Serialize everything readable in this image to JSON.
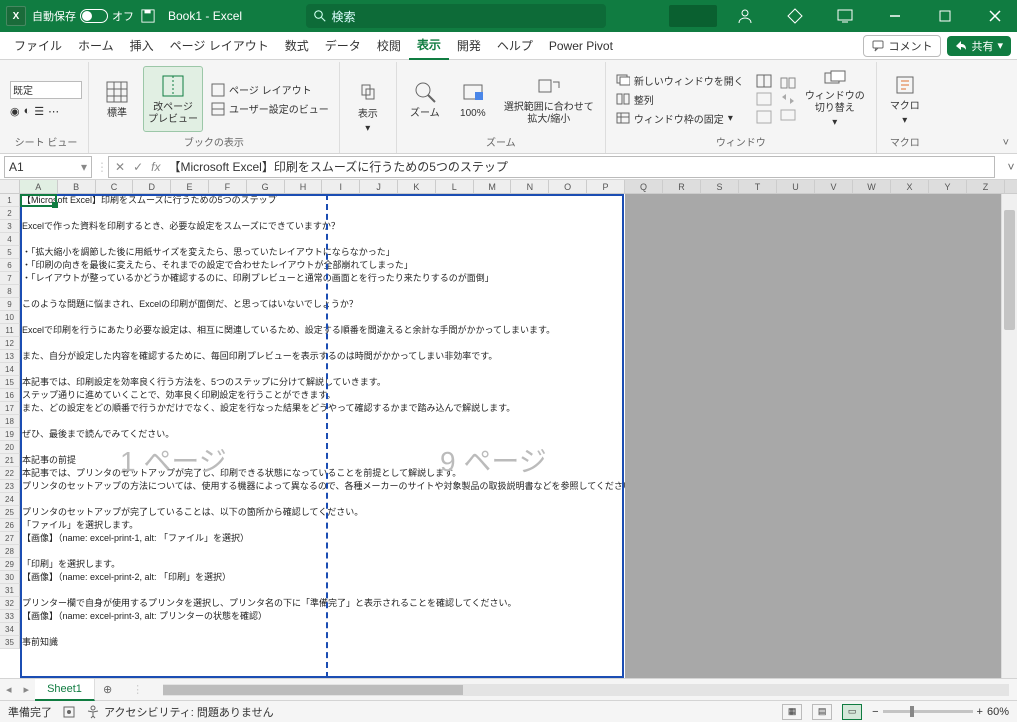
{
  "titlebar": {
    "autosave_label": "自動保存",
    "autosave_state": "オフ",
    "title": "Book1  -  Excel",
    "search_placeholder": "検索"
  },
  "menubar": {
    "tabs": [
      "ファイル",
      "ホーム",
      "挿入",
      "ページ レイアウト",
      "数式",
      "データ",
      "校閲",
      "表示",
      "開発",
      "ヘルプ",
      "Power Pivot"
    ],
    "active_index": 7,
    "comment": "コメント",
    "share": "共有"
  },
  "ribbon": {
    "sheetview": {
      "keep": "既定",
      "label": "シート ビュー"
    },
    "bookview": {
      "normal": "標準",
      "page_break": "改ページ\nプレビュー",
      "page_layout": "ページ レイアウト",
      "custom_view": "ユーザー設定のビュー",
      "label": "ブックの表示"
    },
    "show": {
      "btn": "表示",
      "label": ""
    },
    "zoom": {
      "zoom": "ズーム",
      "pct": "100%",
      "fit": "選択範囲に合わせて\n拡大/縮小",
      "label": "ズーム"
    },
    "window": {
      "new_window": "新しいウィンドウを開く",
      "arrange": "整列",
      "freeze": "ウィンドウ枠の固定",
      "switch": "ウィンドウの\n切り替え",
      "label": "ウィンドウ"
    },
    "macro": {
      "btn": "マクロ",
      "label": "マクロ"
    }
  },
  "formula": {
    "namebox": "A1",
    "value": "【Microsoft Excel】印刷をスムーズに行うための5つのステップ"
  },
  "columns": [
    "A",
    "B",
    "C",
    "D",
    "E",
    "F",
    "G",
    "H",
    "I",
    "J",
    "K",
    "L",
    "M",
    "N",
    "O",
    "P",
    "Q",
    "R",
    "S",
    "T",
    "U",
    "V",
    "W",
    "X",
    "Y",
    "Z"
  ],
  "watermarks": {
    "p1": "1 ページ",
    "p2": "9 ページ"
  },
  "rows": [
    {
      "n": 1,
      "t": "【Microsoft Excel】印刷をスムーズに行うための5つのステップ"
    },
    {
      "n": 2,
      "t": ""
    },
    {
      "n": 3,
      "t": "Excelで作った資料を印刷するとき、必要な設定をスムーズにできていますか？"
    },
    {
      "n": 4,
      "t": ""
    },
    {
      "n": 5,
      "t": "・「拡大縮小を調節した後に用紙サイズを変えたら、思っていたレイアウトにならなかった」"
    },
    {
      "n": 6,
      "t": "・「印刷の向きを最後に変えたら、それまでの設定で合わせたレイアウトが全部崩れてしまった」"
    },
    {
      "n": 7,
      "t": "・「レイアウトが整っているかどうか確認するのに、印刷プレビューと通常の画面とを行ったり来たりするのが面倒」"
    },
    {
      "n": 8,
      "t": ""
    },
    {
      "n": 9,
      "t": "このような問題に悩まされ、Excelの印刷が面倒だ、と思ってはいないでしょうか？"
    },
    {
      "n": 10,
      "t": ""
    },
    {
      "n": 11,
      "t": "Excelで印刷を行うにあたり必要な設定は、相互に関連しているため、設定する順番を間違えると余計な手間がかかってしまいます。"
    },
    {
      "n": 12,
      "t": ""
    },
    {
      "n": 13,
      "t": "また、自分が設定した内容を確認するために、毎回印刷プレビューを表示するのは時間がかかってしまい非効率です。"
    },
    {
      "n": 14,
      "t": ""
    },
    {
      "n": 15,
      "t": "本記事では、印刷設定を効率良く行う方法を、5つのステップに分けて解説していきます。"
    },
    {
      "n": 16,
      "t": "ステップ通りに進めていくことで、効率良く印刷設定を行うことができます。"
    },
    {
      "n": 17,
      "t": "また、どの設定をどの順番で行うかだけでなく、設定を行なった結果をどうやって確認するかまで踏み込んで解説します。"
    },
    {
      "n": 18,
      "t": ""
    },
    {
      "n": 19,
      "t": "ぜひ、最後まで読んでみてください。"
    },
    {
      "n": 20,
      "t": ""
    },
    {
      "n": 21,
      "t": "本記事の前提"
    },
    {
      "n": 22,
      "t": "本記事では、プリンタのセットアップが完了し、印刷できる状態になっていることを前提として解説します。"
    },
    {
      "n": 23,
      "t": "プリンタのセットアップの方法については、使用する機器によって異なるので、各種メーカーのサイトや対象製品の取扱説明書などを参照してください。"
    },
    {
      "n": 24,
      "t": ""
    },
    {
      "n": 25,
      "t": "プリンタのセットアップが完了していることは、以下の箇所から確認してください。"
    },
    {
      "n": 26,
      "t": "「ファイル」を選択します。"
    },
    {
      "n": 27,
      "t": "【画像】（name: excel-print-1, alt: 「ファイル」を選択）"
    },
    {
      "n": 28,
      "t": ""
    },
    {
      "n": 29,
      "t": "「印刷」を選択します。"
    },
    {
      "n": 30,
      "t": "【画像】（name: excel-print-2, alt: 「印刷」を選択）"
    },
    {
      "n": 31,
      "t": ""
    },
    {
      "n": 32,
      "t": "プリンター欄で自身が使用するプリンタを選択し、プリンタ名の下に「準備完了」と表示されることを確認してください。"
    },
    {
      "n": 33,
      "t": "【画像】（name: excel-print-3, alt: プリンターの状態を確認）"
    },
    {
      "n": 34,
      "t": ""
    },
    {
      "n": 35,
      "t": "事前知識"
    }
  ],
  "sheets": {
    "active": "Sheet1"
  },
  "status": {
    "ready": "準備完了",
    "accessibility": "アクセシビリティ: 問題ありません",
    "zoom": "60%"
  }
}
